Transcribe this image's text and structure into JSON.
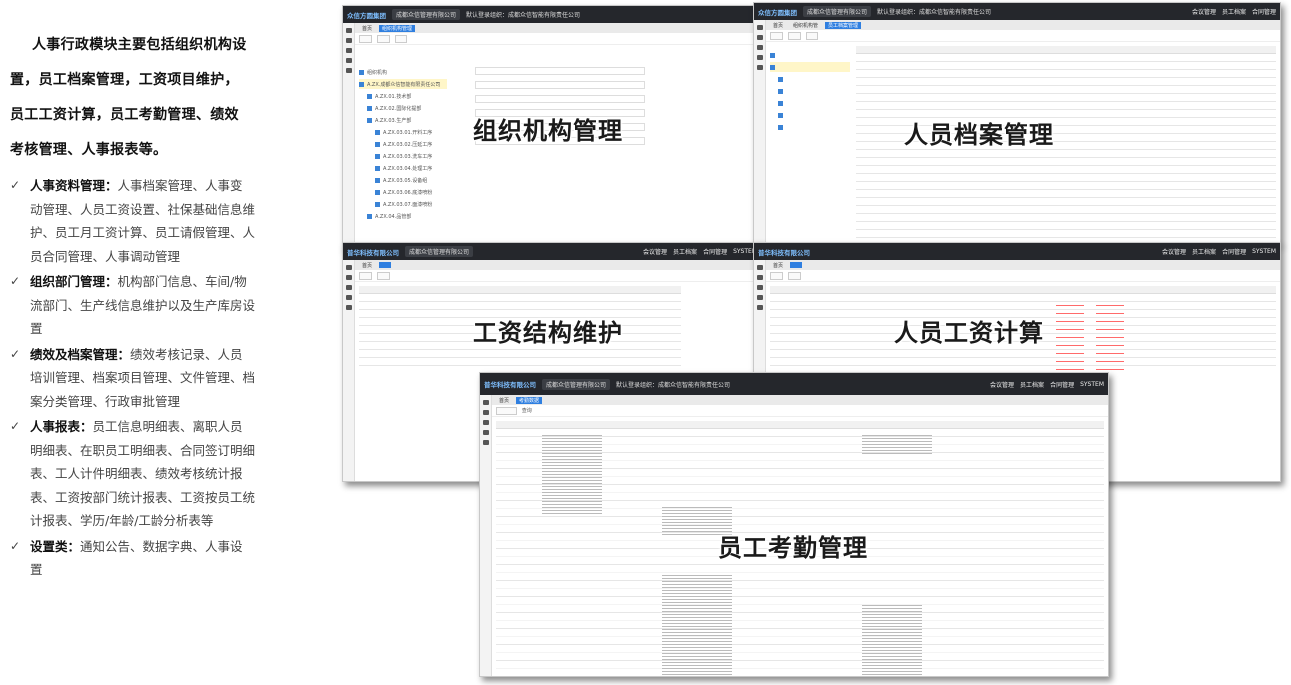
{
  "intro": {
    "lines": [
      "人事行政模块主要包括组织机构设",
      "置，员工档案管理，工资项目维护，",
      "员工工资计算，员工考勤管理、绩效",
      "考核管理、人事报表等。"
    ]
  },
  "features": [
    {
      "title": "人事资料管理：",
      "text": "人事档案管理、人事变动管理、人员工资设置、社保基础信息维护、员工月工资计算、员工请假管理、人员合同管理、人事调动管理"
    },
    {
      "title": "组织部门管理：",
      "text": "机构部门信息、车间/物流部门、生产线信息维护以及生产库房设置"
    },
    {
      "title": "绩效及档案管理：",
      "text": "绩效考核记录、人员培训管理、档案项目管理、文件管理、档案分类管理、行政审批管理"
    },
    {
      "title": "人事报表：",
      "text": "员工信息明细表、离职人员明细表、在职员工明细表、合同签订明细表、工人计件明细表、绩效考核统计报表、工资按部门统计报表、工资按员工统计报表、学历/年龄/工龄分析表等"
    },
    {
      "title": "设置类：",
      "text": "通知公告、数据字典、人事设置"
    }
  ],
  "check_glyph": "✓",
  "windows": {
    "org": {
      "company": "成都众信管理有限公司",
      "notice": "默认登录组织：成都众信智能有限责任公司",
      "tab_home": "首页",
      "tab_active": "组织机构管理",
      "caption": "组织机构管理",
      "tree_items": [
        "组织机构",
        "A.ZX.成都众信智能有限责任公司",
        "A.ZX.01.技术部",
        "A.ZX.02.国际化提部",
        "A.ZX.03.生产部",
        "A.ZX.03.01.开料工序",
        "A.ZX.03.02.压延工序",
        "A.ZX.03.03.洗车工序",
        "A.ZX.03.04.处理工序",
        "A.ZX.03.05.设备组",
        "A.ZX.03.06.底漆喷粉",
        "A.ZX.03.07.面漆喷粉",
        "A.ZX.04.品管部"
      ]
    },
    "staff": {
      "company": "众信方圆集团",
      "tab_home": "首页",
      "tab_a": "组织机构管",
      "tab_active": "员工档案管理",
      "caption": "人员档案管理",
      "menu": [
        "会议管理",
        "员工档案",
        "合同管理"
      ]
    },
    "salary_struct": {
      "company": "普华科技有限公司",
      "caption": "工资结构维护",
      "menu": [
        "会议管理",
        "员工档案",
        "合同管理",
        "SYSTEM"
      ]
    },
    "salary_calc": {
      "caption": "人员工资计算",
      "menu": [
        "会议管理",
        "员工档案",
        "合同管理",
        "SYSTEM"
      ]
    },
    "attendance": {
      "company": "普华科技有限公司",
      "notice": "默认登录组织：成都众信智能有限责任公司",
      "tab_home": "首页",
      "tab_active": "考勤数据",
      "caption": "员工考勤管理",
      "menu": [
        "会议管理",
        "员工档案",
        "合同管理",
        "SYSTEM"
      ],
      "query": "查询"
    }
  }
}
